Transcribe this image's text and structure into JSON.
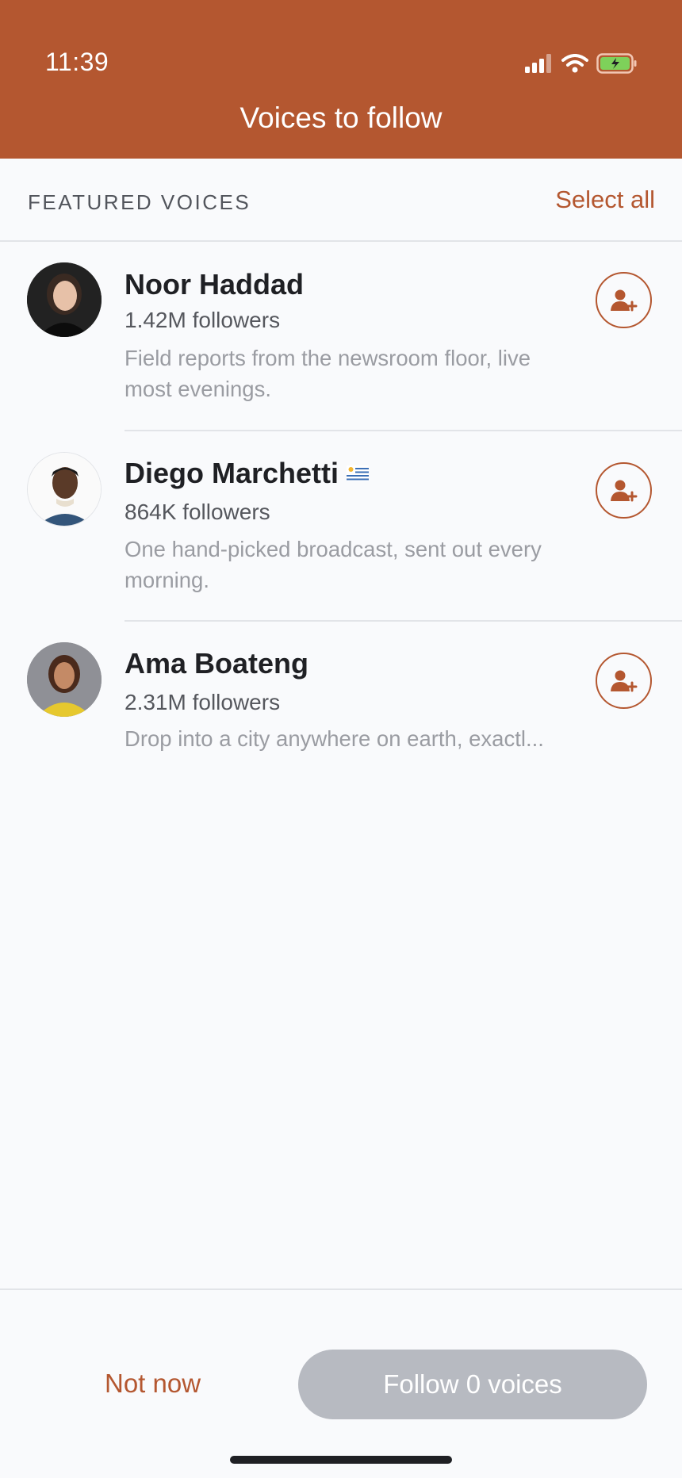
{
  "status": {
    "time": "11:39"
  },
  "header": {
    "title": "Voices to follow"
  },
  "section": {
    "title": "FEATURED VOICES",
    "select_all": "Select all"
  },
  "voices": [
    {
      "name": "Noor Haddad",
      "followers": "1.42M followers",
      "description": "Field reports from the newsroom floor, live most evenings.",
      "flag": ""
    },
    {
      "name": "Diego Marchetti",
      "followers": "864K followers",
      "description": "One hand-picked broadcast, sent out every morning.",
      "flag": "uruguay-flag"
    },
    {
      "name": "Ama Boateng",
      "followers": "2.31M followers",
      "description": "Drop into a city anywhere on earth, exactl...",
      "flag": ""
    }
  ],
  "footer": {
    "not_now": "Not now",
    "follow": "Follow 0 voices"
  },
  "colors": {
    "accent": "#b45730",
    "disabled_button": "#b7bac1",
    "background": "#f9fafc"
  }
}
